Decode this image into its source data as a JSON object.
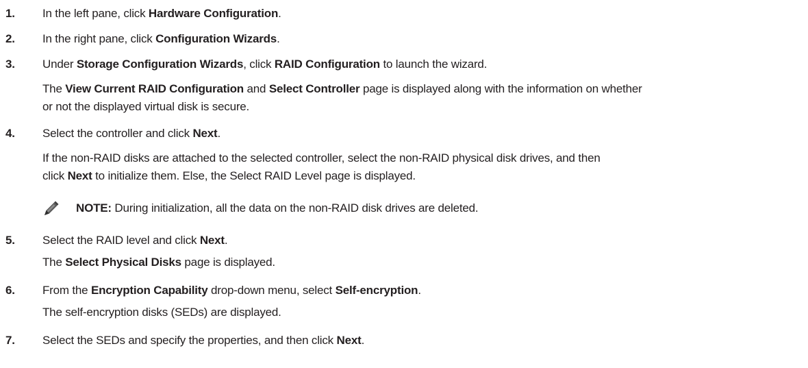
{
  "steps": [
    {
      "num": "1.",
      "pre": "In the left pane, click ",
      "b1": "Hardware Configuration",
      "post": "."
    },
    {
      "num": "2.",
      "pre": "In the right pane, click ",
      "b1": "Configuration Wizards",
      "post": "."
    },
    {
      "num": "3.",
      "pre": "Under ",
      "b1": "Storage Configuration Wizards",
      "mid": ", click ",
      "b2": "RAID Configuration",
      "post": " to launch the wizard.",
      "result": {
        "pre": "The ",
        "b1": "View Current RAID Configuration",
        "mid": " and ",
        "b2": "Select Controller",
        "post1": " page is displayed along with the information on whether",
        "post2": "or not the displayed virtual disk is secure."
      }
    },
    {
      "num": "4.",
      "pre": "Select the controller and click ",
      "b1": "Next",
      "post": ".",
      "result": {
        "line1": "If the non-RAID disks are attached to the selected controller, select the non-RAID physical disk drives, and then",
        "line2_pre": "click ",
        "line2_b": "Next",
        "line2_post": " to initialize them. Else, the Select RAID Level page is displayed."
      },
      "note": {
        "label": "NOTE:",
        "text": " During initialization, all the data on the non-RAID disk drives are deleted."
      }
    },
    {
      "num": "5.",
      "pre": "Select the RAID level and click ",
      "b1": "Next",
      "post": ".",
      "result": {
        "pre": "The ",
        "b1": "Select Physical Disks",
        "post": " page is displayed."
      }
    },
    {
      "num": "6.",
      "pre": "From the ",
      "b1": "Encryption Capability",
      "mid": " drop-down menu, select ",
      "b2": "Self-encryption",
      "post": ".",
      "result": {
        "text": "The self-encryption disks (SEDs) are displayed."
      }
    },
    {
      "num": "7.",
      "pre": "Select the SEDs and specify the properties, and then click ",
      "b1": "Next",
      "post": "."
    }
  ]
}
